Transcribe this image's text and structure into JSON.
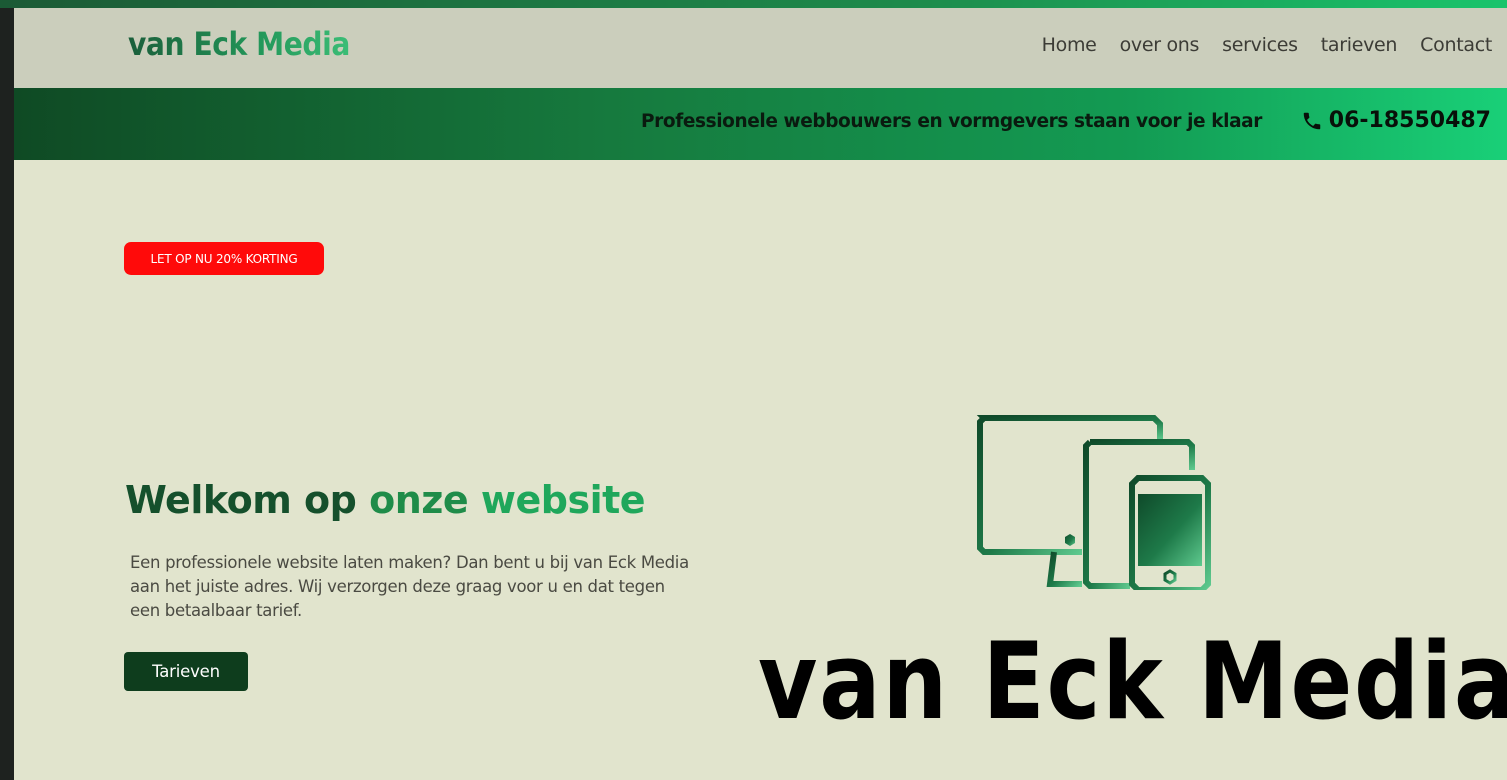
{
  "site": {
    "logo_text": "van Eck Media",
    "nav": [
      "Home",
      "over ons",
      "services",
      "tarieven",
      "Contact"
    ],
    "banner": {
      "tagline": "Professionele webbouwers en vormgevers staan voor je klaar",
      "phone": "06-18550487",
      "phone_icon": "phone-icon"
    },
    "badge": "LET OP NU 20% KORTING",
    "hero": {
      "title_part1": "Welkom op",
      "title_part2": "onze",
      "title_part3": "website",
      "text": "Een professionele website laten maken? Dan bent u bij van Eck Media aan het juiste adres. Wij verzorgen deze graag voor u en dat tegen een betaalbaar tarief.",
      "button_label": "Tarieven"
    },
    "brand_image": {
      "icon": "devices-icon",
      "text": "van Eck Media"
    },
    "colors": {
      "background": "#e1e4cd",
      "navbar": "#cbcebc",
      "badge": "#ff0a0a",
      "button": "#0e3d1d",
      "accent_dark": "#15502c",
      "accent_light": "#1fa75b"
    }
  }
}
